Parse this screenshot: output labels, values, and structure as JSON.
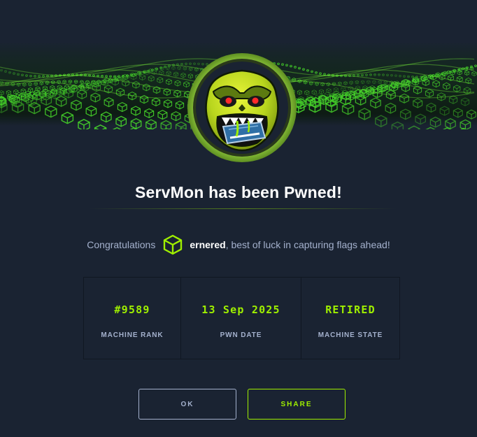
{
  "modal": {
    "title": "ServMon has been Pwned!",
    "congrats_prefix": "Congratulations",
    "username": "ernered",
    "congrats_suffix": ", best of luck in capturing flags ahead!"
  },
  "stats": [
    {
      "value": "#9589",
      "label": "MACHINE RANK"
    },
    {
      "value": "13 Sep 2025",
      "label": "PWN DATE"
    },
    {
      "value": "RETIRED",
      "label": "MACHINE STATE"
    }
  ],
  "buttons": {
    "ok_label": "OK",
    "share_label": "SHARE"
  },
  "colors": {
    "background": "#1a2332",
    "accent": "#9fef00",
    "muted_text": "#a4b1cd"
  },
  "icons": {
    "banner": "green-cube-wave-banner",
    "avatar": "servmon-monster-avatar",
    "user": "hexagon-cube-icon"
  }
}
